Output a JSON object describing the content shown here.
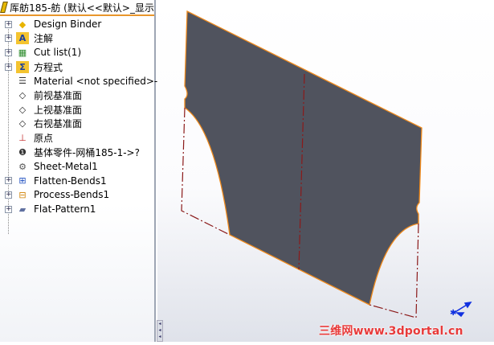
{
  "tree": {
    "title": "厍舫185-舫 (默认<<默认>_显示",
    "items": [
      {
        "label": "Design Binder",
        "icon": "design-binder-icon",
        "expandable": true
      },
      {
        "label": "注解",
        "icon": "annotations-icon",
        "expandable": true
      },
      {
        "label": "Cut list(1)",
        "icon": "cut-list-icon",
        "expandable": true
      },
      {
        "label": "方程式",
        "icon": "equations-icon",
        "expandable": true
      },
      {
        "label": "Material <not specified>->",
        "icon": "material-icon",
        "expandable": false
      },
      {
        "label": "前视基准面",
        "icon": "plane-icon",
        "expandable": false
      },
      {
        "label": "上视基准面",
        "icon": "plane-icon",
        "expandable": false
      },
      {
        "label": "右视基准面",
        "icon": "plane-icon",
        "expandable": false
      },
      {
        "label": "原点",
        "icon": "origin-icon",
        "expandable": false
      },
      {
        "label": "基体零件-网桶185-1->?",
        "icon": "base-part-icon",
        "expandable": false
      },
      {
        "label": "Sheet-Metal1",
        "icon": "sheet-metal-icon",
        "expandable": false
      },
      {
        "label": "Flatten-Bends1",
        "icon": "flatten-bends-icon",
        "expandable": true
      },
      {
        "label": "Process-Bends1",
        "icon": "process-bends-icon",
        "expandable": true
      },
      {
        "label": "Flat-Pattern1",
        "icon": "flat-pattern-icon",
        "expandable": true
      }
    ]
  },
  "watermark": "三维网www.3dportal.cn",
  "colors": {
    "part": "#50535e",
    "edge": "#f08a1c",
    "bendline": "#8b1a1a",
    "triad": "#1030e0"
  }
}
